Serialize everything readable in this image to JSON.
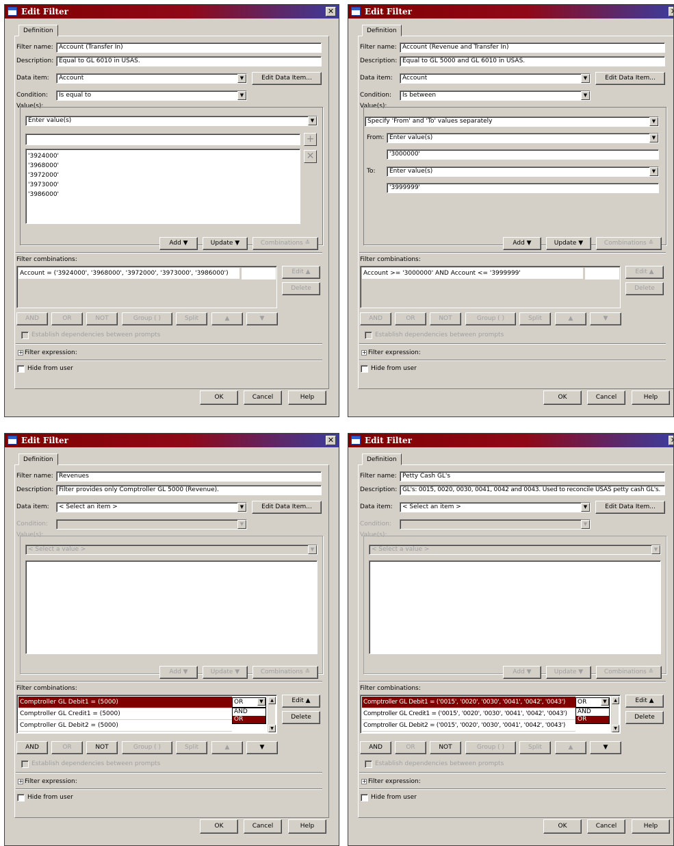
{
  "common": {
    "tab_definition": "Definition",
    "filter_name_label": "Filter name:",
    "description_label": "Description:",
    "data_item_label": "Data item:",
    "condition_label": "Condition:",
    "values_label": "Value(s):",
    "edit_data_item": "Edit Data Item...",
    "add": "Add ▼",
    "update": "Update ▼",
    "combinations": "Combinations ≛",
    "filter_combinations_label": "Filter combinations:",
    "edit": "Edit ▲",
    "delete": "Delete",
    "and": "AND",
    "or": "OR",
    "not": "NOT",
    "group": "Group ( )",
    "split": "Split",
    "up": "▲",
    "down": "▼",
    "establish_dependencies": "Establish dependencies between prompts",
    "filter_expression": "Filter expression:",
    "hide_from_user": "Hide from user",
    "ok": "OK",
    "cancel": "Cancel",
    "help": "Help",
    "from_label": "From:",
    "to_label": "To:",
    "plus": "+",
    "times": "✕"
  },
  "dialogs": [
    {
      "title": "Edit Filter",
      "filter_name": "Account (Transfer In)",
      "description": "Equal to GL 6010 in USAS.",
      "data_item": "Account",
      "condition": "Is equal to",
      "value_mode": "Enter value(s)",
      "values": [
        "'3924000'",
        "'3968000'",
        "'3972000'",
        "'3973000'",
        "'3986000'"
      ],
      "combination": "Account = ('3924000', '3968000', '3972000', '3973000', '3986000')"
    },
    {
      "title": "Edit Filter",
      "filter_name": "Account (Revenue and Transfer In)",
      "description": "Equal to GL 5000 and GL 6010 in USAS.",
      "data_item": "Account",
      "condition": "Is between",
      "value_mode": "Specify 'From' and 'To' values separately",
      "from_mode": "Enter value(s)",
      "from_value": "'3000000'",
      "to_mode": "Enter value(s)",
      "to_value": "'3999999'",
      "combination": "Account >= '3000000' AND Account <= '3999999'"
    },
    {
      "title": "Edit Filter",
      "filter_name": "Revenues",
      "description": "Filter provides only Comptroller GL 5000 (Revenue).",
      "data_item": "< Select an item >",
      "value_placeholder": "< Select a value >",
      "combinations": [
        "Comptroller GL Debit1 = (5000)",
        "Comptroller GL Credit1 = (5000)",
        "Comptroller GL Debit2 = (5000)"
      ],
      "operator": "OR",
      "operator_options": [
        "AND",
        "OR"
      ]
    },
    {
      "title": "Edit Filter",
      "filter_name": "Petty Cash GL's",
      "description": "GL's: 0015, 0020, 0030, 0041, 0042 and 0043. Used to reconcile USAS petty cash GL's.",
      "data_item": "< Select an item >",
      "value_placeholder": "< Select a value >",
      "combinations": [
        "Comptroller GL Debit1 = ('0015', '0020', '0030', '0041', '0042', '0043')",
        "Comptroller GL Credit1 = ('0015', '0020', '0030', '0041', '0042', '0043')",
        "Comptroller GL Debit2 = ('0015', '0020', '0030', '0041', '0042', '0043')"
      ],
      "operator": "OR",
      "operator_options": [
        "AND",
        "OR"
      ]
    }
  ]
}
